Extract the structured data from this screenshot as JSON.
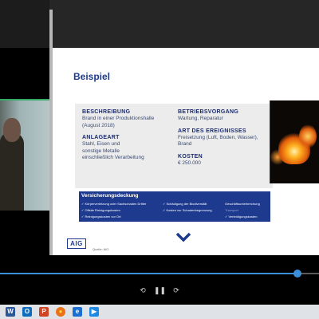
{
  "slide": {
    "title": "Beispiel",
    "beschreibung": {
      "heading": "BESCHREIBUNG",
      "lines": [
        "Brand in einer Produktionshalle",
        "(August 2018)"
      ]
    },
    "anlageart": {
      "heading": "ANLAGEART",
      "lines": [
        "Stahl, Eisen und",
        "sonstige Metalle",
        "einschließlich Verarbeitung"
      ]
    },
    "betriebsvorgang": {
      "heading": "BETRIEBSVORGANG",
      "lines": [
        "Wartung, Reparatur"
      ]
    },
    "ereignis": {
      "heading": "ART DES EREIGNISSES",
      "lines": [
        "Freisetzung (Luft, Boden, Wasser),",
        "Brand"
      ]
    },
    "kosten": {
      "heading": "KOSTEN",
      "value": "€ 250.000"
    },
    "deckung": {
      "heading": "Versicherungsdeckung",
      "items": [
        "✓ Körperverletzung oder Sachschaden Dritter",
        "✓ Schädigung der Biodiversität",
        "Geschäftsunterbrechung",
        "✓ Offsite Reinigungskosten",
        "✓ Kosten zur Schadenbegrenzung",
        "Transport",
        "✓ Reinigungskosten vor Ort",
        "✓ Verteidigungskosten"
      ]
    },
    "logo": "AIG",
    "source": "Quelle: AIG"
  },
  "player": {
    "progress_fraction": 0.933,
    "accent_color": "#3a8fd8",
    "controls": [
      "rewind-icon",
      "pause-icon",
      "forward-icon"
    ]
  },
  "taskbar": {
    "icons": [
      {
        "name": "word-icon",
        "glyph": "W",
        "color": "#2b5797"
      },
      {
        "name": "outlook-icon",
        "glyph": "O",
        "color": "#0f6cbd"
      },
      {
        "name": "powerpoint-icon",
        "glyph": "P",
        "color": "#d04423"
      },
      {
        "name": "firefox-icon",
        "glyph": "●",
        "color": "#e8711a"
      },
      {
        "name": "ie-icon",
        "glyph": "e",
        "color": "#1a6fd0"
      },
      {
        "name": "media-player-icon",
        "glyph": "▶",
        "color": "#1e88e5"
      }
    ]
  }
}
